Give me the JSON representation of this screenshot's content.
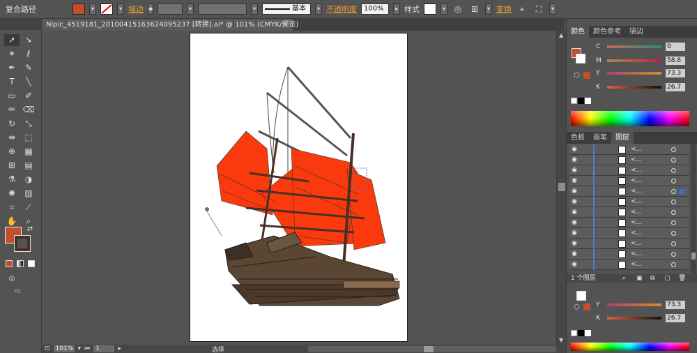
{
  "toolbar": {
    "selection_type": "复合路径",
    "stroke_label": "描边",
    "stroke_style": "基本",
    "opacity_label": "不透明度",
    "opacity_value": "100%",
    "style_label": "样式",
    "transform_label": "变换",
    "fill_color": "#c24e2c"
  },
  "document": {
    "tab_title": "Nipic_4519181_20100415163624095237 [转换].ai* @ 101% (CMYK/预览)",
    "close": "×"
  },
  "status": {
    "zoom": "101%",
    "page": "1",
    "tool": "选择"
  },
  "color_panel": {
    "tabs": [
      "颜色",
      "颜色参考",
      "描边"
    ],
    "channels": [
      {
        "letter": "C",
        "value": "0"
      },
      {
        "letter": "M",
        "value": "58.8"
      },
      {
        "letter": "Y",
        "value": "73.3"
      },
      {
        "letter": "K",
        "value": "26.7"
      }
    ]
  },
  "layers_panel": {
    "tabs": [
      "色板",
      "画笔",
      "图层"
    ],
    "rows": [
      "<...",
      "<...",
      "<...",
      "<...",
      "<...",
      "<...",
      "<...",
      "<...",
      "<...",
      "<...",
      "<...",
      "<..."
    ],
    "footer": "1 个图层"
  },
  "second_panel": {
    "channels": [
      {
        "letter": "Y",
        "value": "73.3"
      },
      {
        "letter": "K",
        "value": "26.7"
      }
    ]
  }
}
